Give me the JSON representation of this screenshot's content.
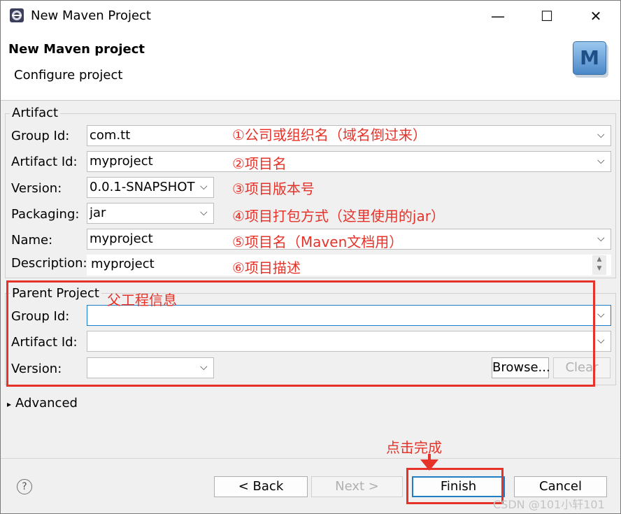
{
  "window": {
    "title": "New Maven Project",
    "minimize_glyph": "—",
    "maximize_glyph": "☐",
    "close_glyph": "✕"
  },
  "header": {
    "title": "New Maven project",
    "subtitle": "Configure project",
    "logo_letter": "M",
    "logo_icon": "maven-logo-icon"
  },
  "artifact": {
    "group_title": "Artifact",
    "fields": {
      "group_id": {
        "label": "Group Id:",
        "value": "com.tt"
      },
      "artifact_id": {
        "label": "Artifact Id:",
        "value": "myproject"
      },
      "version": {
        "label": "Version:",
        "value": "0.0.1-SNAPSHOT"
      },
      "packaging": {
        "label": "Packaging:",
        "value": "jar"
      },
      "name": {
        "label": "Name:",
        "value": "myproject"
      },
      "description": {
        "label": "Description:",
        "value": "myproject"
      }
    }
  },
  "parent": {
    "group_title": "Parent Project",
    "group_id_label": "Group Id:",
    "group_id_value": "",
    "artifact_id_label": "Artifact Id:",
    "artifact_id_value": "",
    "version_label": "Version:",
    "version_value": "",
    "browse_label": "Browse...",
    "clear_label": "Clear"
  },
  "advanced": {
    "label": "Advanced",
    "arrow": "▸"
  },
  "annotations": {
    "group_id": "①公司或组织名（域名倒过来）",
    "artifact_id": "②项目名",
    "version": "③项目版本号",
    "packaging": "④项目打包方式（这里使用的jar）",
    "name": "⑤项目名（Maven文档用）",
    "description": "⑥项目描述",
    "parent": "父工程信息",
    "finish": "点击完成",
    "color": "#e5332a"
  },
  "footer": {
    "help_glyph": "?",
    "back_label": "< Back",
    "next_label": "Next >",
    "finish_label": "Finish",
    "cancel_label": "Cancel"
  },
  "watermark": "CSDN @101小轩101"
}
